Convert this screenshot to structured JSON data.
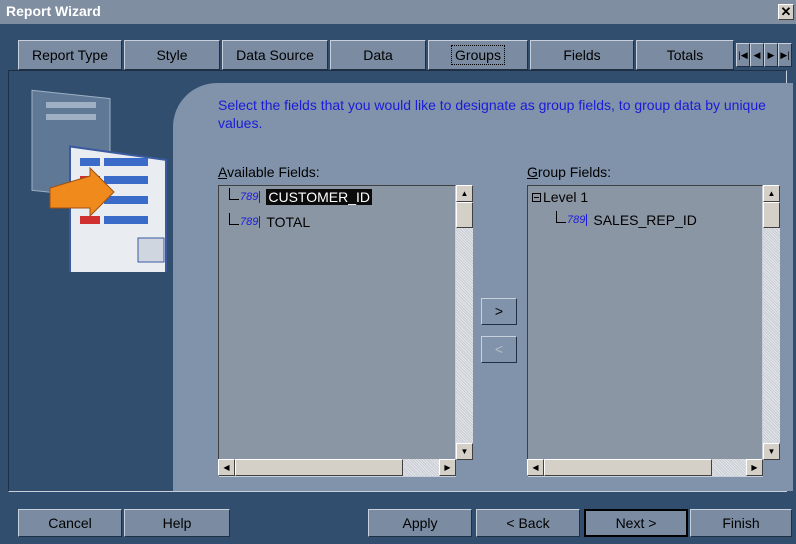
{
  "window": {
    "title": "Report Wizard",
    "close_glyph": "✕"
  },
  "tabs": [
    {
      "label": "Report Type",
      "active": false
    },
    {
      "label": "Style",
      "active": false
    },
    {
      "label": "Data Source",
      "active": false
    },
    {
      "label": "Data",
      "active": false
    },
    {
      "label": "Groups",
      "active": true
    },
    {
      "label": "Fields",
      "active": false
    },
    {
      "label": "Totals",
      "active": false
    }
  ],
  "tab_scroll_glyphs": [
    "|◀",
    "◀",
    "▶",
    "▶|"
  ],
  "instructions": "Select the fields that you would like to designate as group fields, to group data by unique values.",
  "available": {
    "label_prefix": "A",
    "label_rest": "vailable Fields:",
    "items": [
      {
        "icon": "789",
        "label": "CUSTOMER_ID",
        "selected": true
      },
      {
        "icon": "789",
        "label": "TOTAL",
        "selected": false
      }
    ]
  },
  "group": {
    "label_prefix": "G",
    "label_rest": "roup Fields:",
    "level_label": "Level 1",
    "items": [
      {
        "icon": "789",
        "label": "SALES_REP_ID"
      }
    ]
  },
  "move_buttons": {
    "add": ">",
    "remove": "<"
  },
  "scroll_glyphs": {
    "up": "▲",
    "down": "▼",
    "left": "◀",
    "right": "▶"
  },
  "buttons": {
    "cancel": "Cancel",
    "help": "Help",
    "apply": "Apply",
    "back": "< Back",
    "next": "Next >",
    "finish": "Finish"
  },
  "colors": {
    "window_bg": "#314e6f",
    "panel_bg": "#8093aa",
    "instruction_text": "#1b1bd8",
    "selection_bg": "#0b0b0b"
  }
}
